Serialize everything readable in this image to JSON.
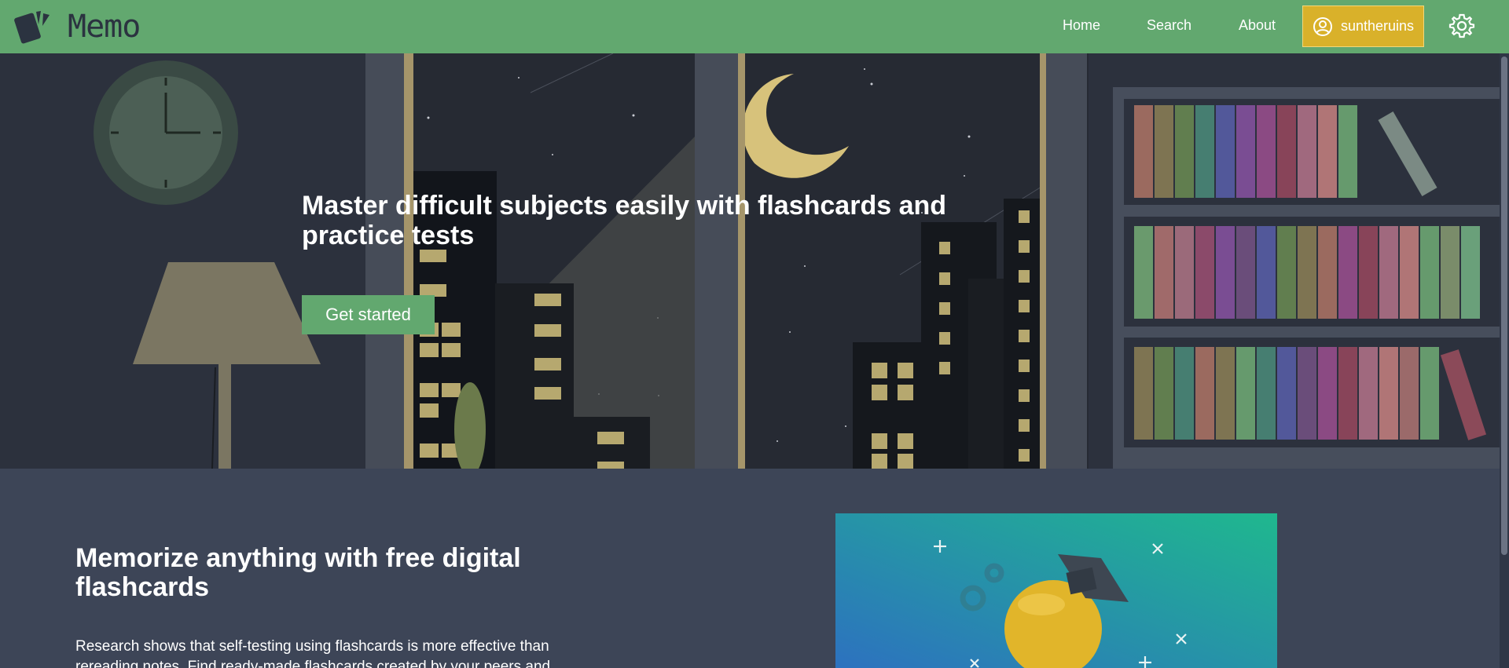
{
  "app": {
    "name": "Memo",
    "logo_icon": "cards-icon"
  },
  "nav": {
    "links": [
      {
        "label": "Home"
      },
      {
        "label": "Search"
      },
      {
        "label": "About"
      }
    ],
    "user": {
      "username": "suntheruins",
      "icon": "user-circle-icon"
    },
    "settings_icon": "gear-icon"
  },
  "hero": {
    "title": "Master difficult subjects easily with flashcards and practice tests",
    "cta_label": "Get started"
  },
  "features": {
    "title": "Memorize anything with free digital flashcards",
    "body": "Research shows that self-testing using flashcards is more effective than rereading notes. Find ready-made flashcards created by your peers and"
  },
  "colors": {
    "nav_bg": "#62a86f",
    "accent_user": "#d9b12a",
    "hero_bg": "#2c313d",
    "section_bg": "#3d4557"
  }
}
